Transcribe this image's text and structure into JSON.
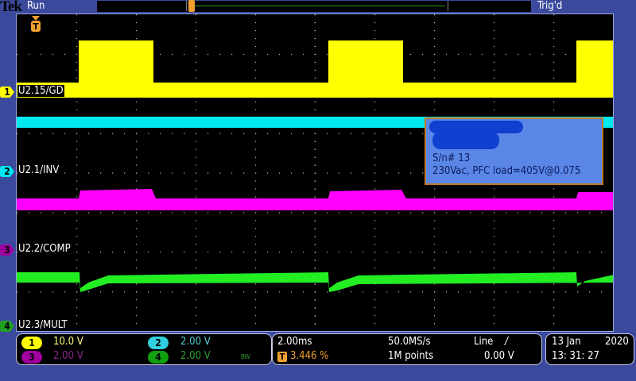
{
  "header": {
    "brand": "Tek",
    "run_state": "Run",
    "trigger_state": "Trig'd"
  },
  "channels": [
    {
      "number": "1",
      "label": "U2.15/GD",
      "scale": "10.0 V",
      "color": "#ffff00"
    },
    {
      "number": "2",
      "label": "U2.1/INV",
      "scale": "2.00 V",
      "color": "#00e8f0"
    },
    {
      "number": "3",
      "label": "U2.2/COMP",
      "scale": "2.00 V",
      "color": "#ff00ff"
    },
    {
      "number": "4",
      "label": "U2.3/MULT",
      "scale": "2.00 V",
      "color": "#00ff00"
    }
  ],
  "bandwidth_limit": "BW",
  "note": {
    "serial": "S/n# 13",
    "condition": "230Vac, PFC load=405V@0.075"
  },
  "horizontal": {
    "timebase": "2.00ms",
    "trigger_position_icon": "T",
    "trigger_position": "3.446 %",
    "sample_rate": "50.0MS/s",
    "record_length": "1M points"
  },
  "trigger": {
    "source": "Line",
    "slope_icon": "/",
    "level": "0.00 V"
  },
  "datetime": {
    "date": "13 Jan",
    "year": "2020",
    "time": "13: 31: 27"
  },
  "colors": {
    "background": "#3b4a9c",
    "trigger_marker": "#f0a030"
  }
}
